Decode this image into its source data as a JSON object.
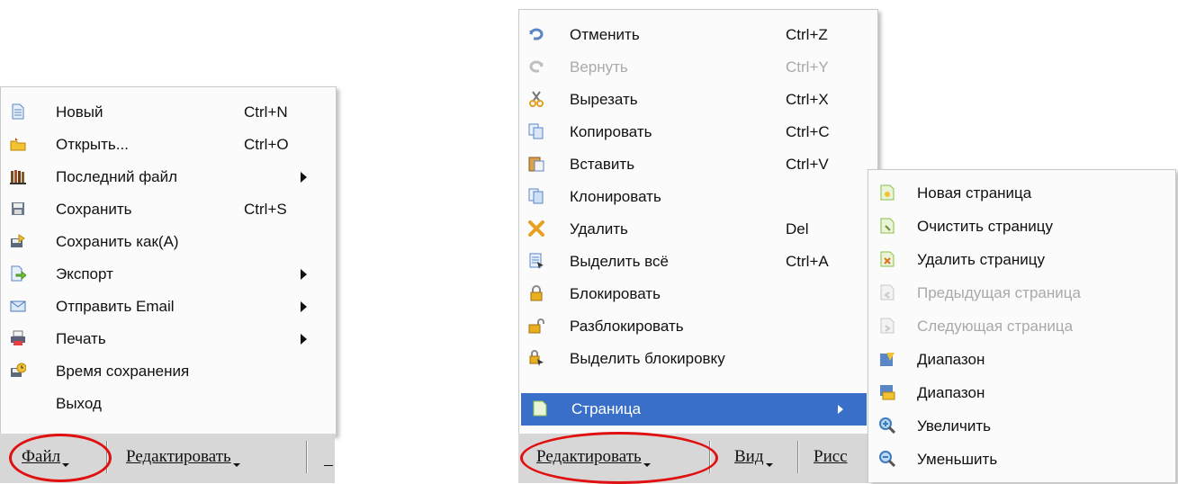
{
  "file_menu": {
    "items": [
      {
        "label": "Новый",
        "shortcut": "Ctrl+N",
        "icon": "new-file-icon"
      },
      {
        "label": "Открыть...",
        "shortcut": "Ctrl+O",
        "icon": "open-folder-icon"
      },
      {
        "label": "Последний файл",
        "icon": "recent-files-icon",
        "submenu": true
      },
      {
        "label": "Сохранить",
        "shortcut": "Ctrl+S",
        "icon": "save-icon"
      },
      {
        "label": "Сохранить как(A)",
        "icon": "save-as-icon"
      },
      {
        "label": "Экспорт",
        "icon": "export-icon",
        "submenu": true
      },
      {
        "label": "Отправить Email",
        "icon": "email-icon",
        "submenu": true
      },
      {
        "label": "Печать",
        "icon": "printer-icon",
        "submenu": true
      },
      {
        "label": "Время сохранения",
        "icon": "save-time-icon"
      },
      {
        "label": "Выход"
      }
    ]
  },
  "edit_menu": {
    "items": [
      {
        "label": "Отменить",
        "shortcut": "Ctrl+Z",
        "icon": "undo-icon"
      },
      {
        "label": "Вернуть",
        "shortcut": "Ctrl+Y",
        "icon": "redo-icon",
        "disabled": true
      },
      {
        "label": "Вырезать",
        "shortcut": "Ctrl+X",
        "icon": "scissors-icon"
      },
      {
        "label": "Копировать",
        "shortcut": "Ctrl+C",
        "icon": "copy-icon"
      },
      {
        "label": "Вставить",
        "shortcut": "Ctrl+V",
        "icon": "paste-icon"
      },
      {
        "label": "Клонировать",
        "icon": "clone-icon"
      },
      {
        "label": "Удалить",
        "shortcut": "Del",
        "icon": "delete-x-icon"
      },
      {
        "label": "Выделить всё",
        "shortcut": "Ctrl+A",
        "icon": "select-all-icon"
      },
      {
        "label": "Блокировать",
        "icon": "lock-icon"
      },
      {
        "label": "Разблокировать",
        "icon": "unlock-icon"
      },
      {
        "label": "Выделить блокировку",
        "icon": "select-locked-icon"
      },
      {
        "label": "Страница",
        "icon": "page-icon",
        "submenu": true,
        "highlighted": true
      }
    ]
  },
  "page_submenu": {
    "items": [
      {
        "label": "Новая страница",
        "icon": "new-page-icon"
      },
      {
        "label": "Очистить страницу",
        "icon": "clear-page-icon"
      },
      {
        "label": "Удалить страницу",
        "icon": "delete-page-icon"
      },
      {
        "label": "Предыдущая страница",
        "icon": "previous-page-icon",
        "disabled": true
      },
      {
        "label": "Следующая страница",
        "icon": "next-page-icon",
        "disabled": true
      },
      {
        "label": "Диапазон",
        "icon": "range-icon"
      },
      {
        "label": "Диапазон",
        "icon": "range-alt-icon"
      },
      {
        "label": "Увеличить",
        "icon": "zoom-in-icon"
      },
      {
        "label": "Уменьшить",
        "icon": "zoom-out-icon"
      }
    ]
  },
  "menubar_left": {
    "file": "Файл",
    "edit": "Редактировать"
  },
  "menubar_right": {
    "edit": "Редактировать",
    "view": "Вид",
    "draw_partial": "Рисс"
  },
  "colors": {
    "highlight": "#3a6fc9",
    "annotation": "#e01010",
    "menubar": "#d7d7d7"
  }
}
